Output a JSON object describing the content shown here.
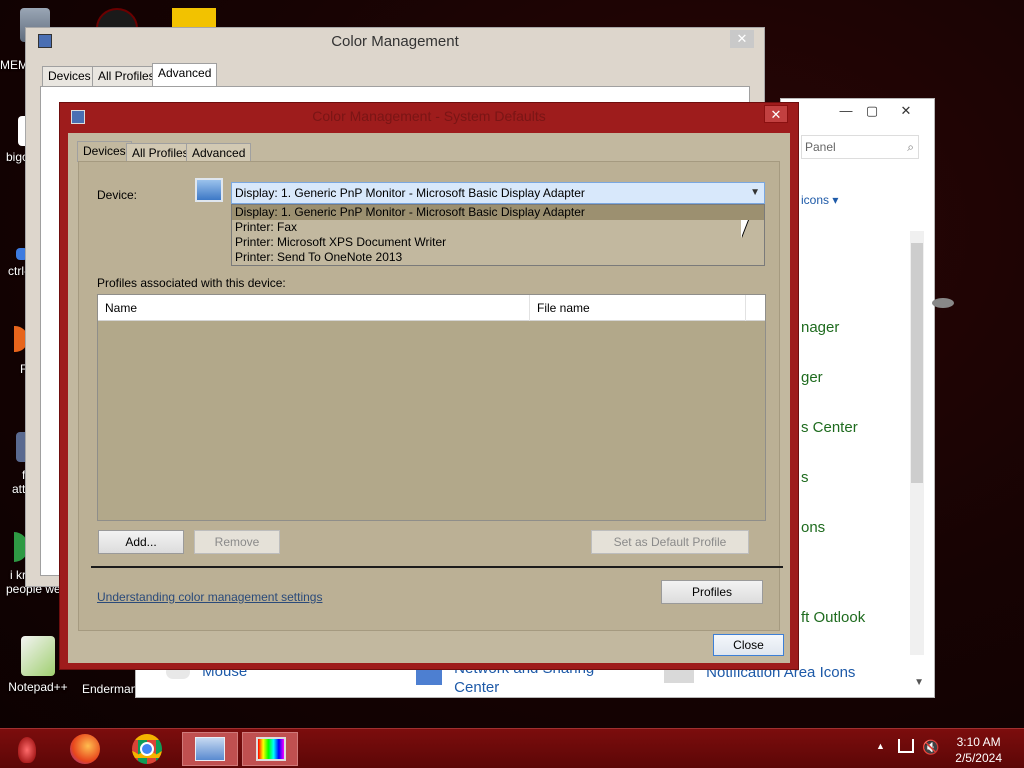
{
  "desktop": {
    "icons": [
      {
        "label": "MEM"
      },
      {
        "label": "bigo"
      },
      {
        "label": "ctrl-"
      },
      {
        "label": "F"
      },
      {
        "label": "f"
      },
      {
        "label": "att"
      },
      {
        "label": "i kr"
      },
      {
        "label": "people we"
      },
      {
        "label": "Notepad++"
      },
      {
        "label": "Enderman"
      }
    ]
  },
  "control_panel": {
    "search_placeholder": "Panel",
    "view_label": "icons",
    "links": [
      "nager",
      "ger",
      "s Center",
      "s",
      "ons",
      "ft Outlook"
    ],
    "bottom_items": [
      "Mouse",
      "Network and Sharing Center",
      "Notification Area Icons"
    ]
  },
  "cm_back": {
    "title": "Color Management",
    "close_label": "✕",
    "tabs": [
      "Devices",
      "All Profiles",
      "Advanced"
    ]
  },
  "dialog": {
    "title": "Color Management - System Defaults",
    "close_label": "✕",
    "tabs": [
      "Devices",
      "All Profiles",
      "Advanced"
    ],
    "device_label": "Device:",
    "device_selected": "Display: 1. Generic PnP Monitor - Microsoft Basic Display Adapter",
    "device_options": [
      "Display: 1. Generic PnP Monitor - Microsoft Basic Display Adapter",
      "Printer: Fax",
      "Printer: Microsoft XPS Document Writer",
      "Printer: Send To OneNote 2013"
    ],
    "profiles_label": "Profiles associated with this device:",
    "columns": [
      "Name",
      "File name"
    ],
    "add_label": "Add...",
    "remove_label": "Remove",
    "set_default_label": "Set as Default Profile",
    "link_label": "Understanding color management settings",
    "profiles_button": "Profiles",
    "close_button": "Close"
  },
  "taskbar": {
    "time": "3:10 AM",
    "date": "2/5/2024"
  },
  "colors": {
    "dialog_frame": "#9e1c1c",
    "dialog_client": "#c2b89f",
    "taskbar": "#6c0a0a"
  }
}
